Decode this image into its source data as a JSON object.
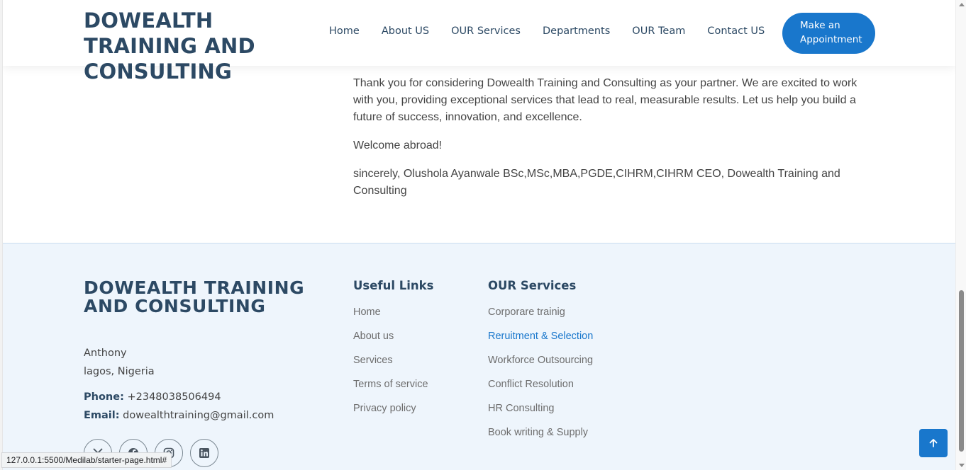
{
  "header": {
    "brand": "DOWEALTH TRAINING AND CONSULTING",
    "nav": [
      "Home",
      "About US",
      "OUR Services",
      "Departments",
      "OUR Team",
      "Contact US"
    ],
    "cta": "Make an Appointment"
  },
  "content": {
    "paragraphs": [
      "Thank you for considering Dowealth Training and Consulting as your partner. We are excited to work with you, providing exceptional services that lead to real, measurable results. Let us help you build a future of success, innovation, and excellence.",
      "Welcome abroad!",
      "sincerely, Olushola Ayanwale BSc,MSc,MBA,PGDE,CIHRM,CIHRM CEO, Dowealth Training and Consulting"
    ]
  },
  "footer": {
    "brand": "DOWEALTH TRAINING AND CONSULTING",
    "address": [
      "Anthony",
      "lagos, Nigeria"
    ],
    "phone_label": "Phone:",
    "phone": "+2348038506494",
    "email_label": "Email:",
    "email": "dowealthtraining@gmail.com",
    "socials": [
      "x-twitter-icon",
      "facebook-icon",
      "instagram-icon",
      "linkedin-icon"
    ],
    "useful_links": {
      "title": "Useful Links",
      "items": [
        "Home",
        "About us",
        "Services",
        "Terms of service",
        "Privacy policy"
      ]
    },
    "services": {
      "title": "OUR Services",
      "items": [
        "Corporare trainig",
        "Reruitment & Selection",
        "Workforce Outsourcing",
        "Conflict Resolution",
        "HR Consulting",
        "Book writing & Supply"
      ],
      "active_index": 1
    }
  },
  "status_bar": "127.0.0.1:5500/Medilab/starter-page.html#",
  "colors": {
    "accent": "#1977cc",
    "heading": "#2c4964",
    "footer_bg": "#eef5fc"
  }
}
